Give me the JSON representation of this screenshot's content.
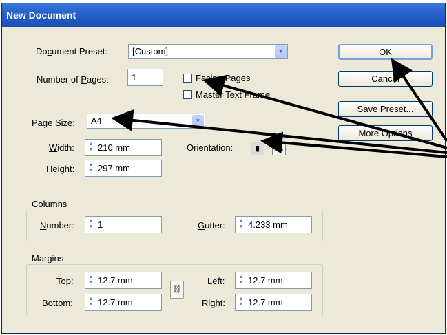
{
  "window": {
    "title": "New Document"
  },
  "preset": {
    "label_pre": "Do",
    "label_acc": "c",
    "label_post": "ument Preset:",
    "value": "[Custom]"
  },
  "pages": {
    "label_pre": "Number of ",
    "label_acc": "P",
    "label_post": "ages:",
    "value": "1"
  },
  "facing_pages": {
    "label": "Facing Pages",
    "checked": false
  },
  "master_text_frame": {
    "label": "Master Text Frame",
    "checked": false
  },
  "page_size": {
    "label_pre": "Page ",
    "label_acc": "S",
    "label_post": "ize:",
    "value": "A4"
  },
  "width": {
    "label_acc": "W",
    "label_post": "idth:",
    "value": "210 mm"
  },
  "height": {
    "label_acc": "H",
    "label_post": "eight:",
    "value": "297 mm"
  },
  "orientation": {
    "label": "Orientation:",
    "selected": "portrait"
  },
  "columns": {
    "group_label": "Columns",
    "number_label_acc": "N",
    "number_label_post": "umber:",
    "number_value": "1",
    "gutter_label_acc": "G",
    "gutter_label_post": "utter:",
    "gutter_value": "4.233 mm"
  },
  "margins": {
    "group_label": "Margins",
    "top_label_acc": "T",
    "top_label_post": "op:",
    "top_value": "12.7 mm",
    "bottom_label_acc": "B",
    "bottom_label_post": "ottom:",
    "bottom_value": "12.7 mm",
    "left_label_acc": "L",
    "left_label_post": "eft:",
    "left_value": "12.7 mm",
    "right_label_acc": "R",
    "right_label_post": "ight:",
    "right_value": "12.7 mm"
  },
  "buttons": {
    "ok": "OK",
    "cancel": "Cancel",
    "save_preset": "Save Preset...",
    "more_options": "More Options"
  },
  "icons": {
    "dropdown": "chevron-down-icon",
    "spinner": "spinner-arrows-icon",
    "portrait": "portrait-orientation-icon",
    "landscape": "landscape-orientation-icon",
    "chain": "chain-link-icon",
    "annotation_arrow": "annotation-arrow"
  },
  "colors": {
    "titlebar": "#2563cc",
    "dialog_bg": "#ece9d8",
    "annotation": "#000000"
  }
}
